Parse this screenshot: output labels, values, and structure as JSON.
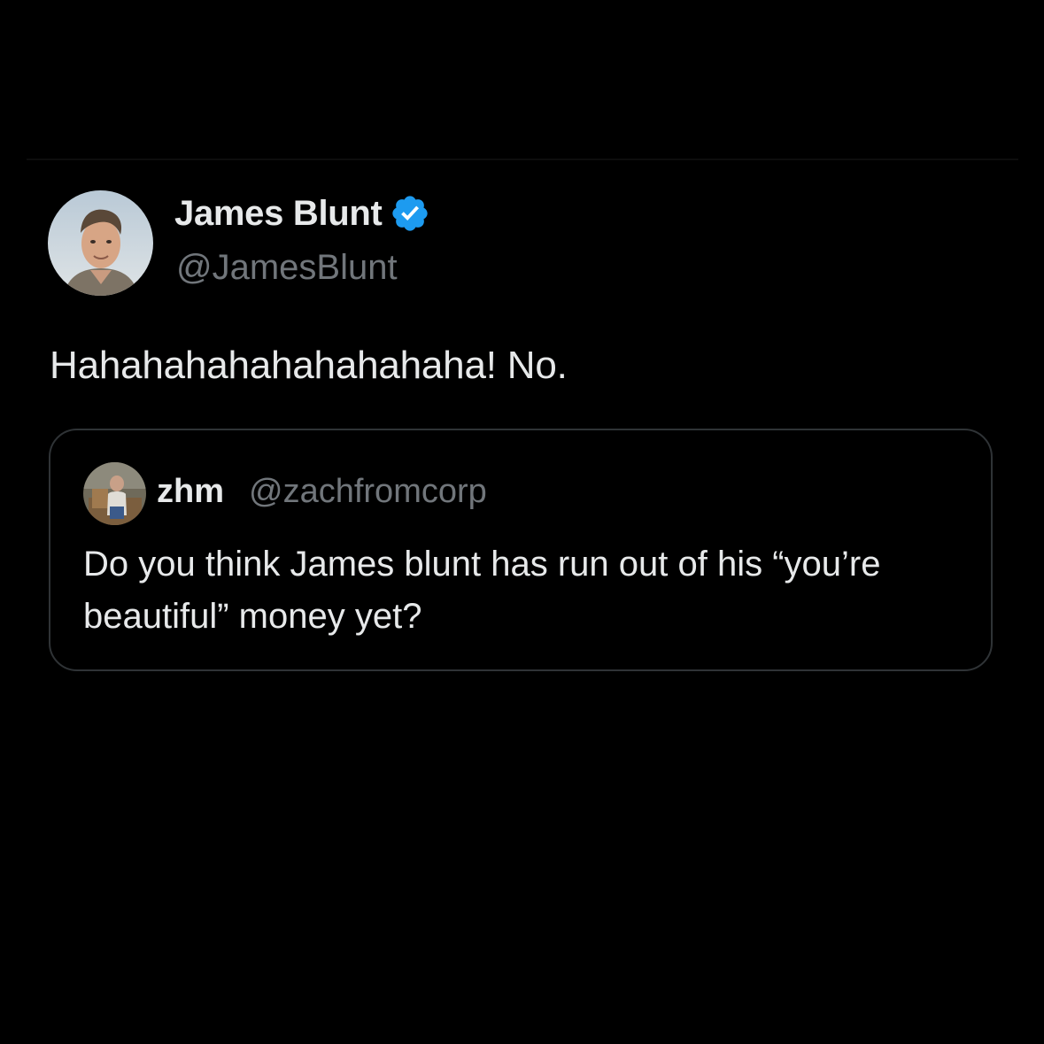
{
  "tweet": {
    "author": {
      "display_name": "James Blunt",
      "handle": "@JamesBlunt",
      "verified": true,
      "avatar_icon": "profile-photo"
    },
    "text": "Hahahahahahahahahaha! No.",
    "quoted": {
      "author": {
        "display_name": "zhm",
        "handle": "@zachfromcorp",
        "avatar_icon": "profile-photo"
      },
      "text": "Do you think James blunt has run out of his “you’re beautiful” money yet?"
    }
  },
  "colors": {
    "background": "#000000",
    "primary_text": "#e7e9ea",
    "secondary_text": "#71767b",
    "verified_badge": "#1d9bf0",
    "card_border": "#2f3336"
  }
}
